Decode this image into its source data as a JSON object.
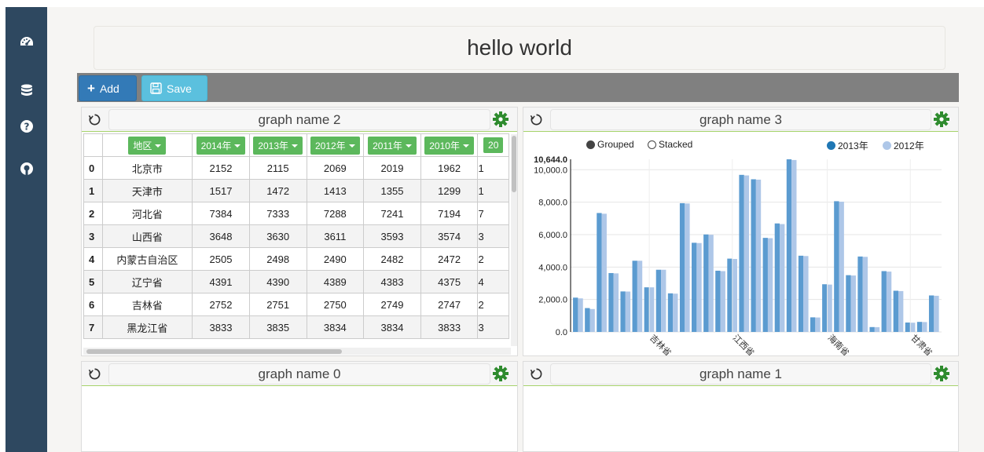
{
  "header": {
    "title": "hello world"
  },
  "toolbar": {
    "add_label": "Add",
    "save_label": "Save"
  },
  "sidebar": {
    "items": [
      {
        "icon": "dashboard-icon"
      },
      {
        "icon": "database-icon"
      },
      {
        "icon": "help-icon"
      },
      {
        "icon": "github-icon"
      }
    ]
  },
  "panels": {
    "p2": {
      "title": "graph name 2"
    },
    "p3": {
      "title": "graph name 3"
    },
    "p0": {
      "title": "graph name 0"
    },
    "p1": {
      "title": "graph name 1"
    }
  },
  "table": {
    "columns": [
      "地区",
      "2014年",
      "2013年",
      "2012年",
      "2011年",
      "2010年",
      "20"
    ],
    "rows": [
      {
        "idx": "0",
        "region": "北京市",
        "v": [
          "2152",
          "2115",
          "2069",
          "2019",
          "1962",
          "1"
        ]
      },
      {
        "idx": "1",
        "region": "天津市",
        "v": [
          "1517",
          "1472",
          "1413",
          "1355",
          "1299",
          "1"
        ]
      },
      {
        "idx": "2",
        "region": "河北省",
        "v": [
          "7384",
          "7333",
          "7288",
          "7241",
          "7194",
          "7"
        ]
      },
      {
        "idx": "3",
        "region": "山西省",
        "v": [
          "3648",
          "3630",
          "3611",
          "3593",
          "3574",
          "3"
        ]
      },
      {
        "idx": "4",
        "region": "内蒙古自治区",
        "v": [
          "2505",
          "2498",
          "2490",
          "2482",
          "2472",
          "2"
        ]
      },
      {
        "idx": "5",
        "region": "辽宁省",
        "v": [
          "4391",
          "4390",
          "4389",
          "4383",
          "4375",
          "4"
        ]
      },
      {
        "idx": "6",
        "region": "吉林省",
        "v": [
          "2752",
          "2751",
          "2750",
          "2749",
          "2747",
          "2"
        ]
      },
      {
        "idx": "7",
        "region": "黑龙江省",
        "v": [
          "3833",
          "3835",
          "3834",
          "3834",
          "3833",
          "3"
        ]
      }
    ]
  },
  "chart_controls": {
    "grouped_label": "Grouped",
    "stacked_label": "Stacked",
    "mode": "Grouped"
  },
  "colors": {
    "series_2013": "#5b9bd0",
    "series_2012": "#aec7e8",
    "panel_accent": "#a6d36b",
    "gear": "#2e8b2e"
  },
  "chart_data": {
    "type": "bar",
    "series": [
      {
        "name": "2013年",
        "values": [
          2115,
          1472,
          7333,
          3630,
          2498,
          4390,
          2751,
          3835,
          2380,
          7939,
          5498,
          6010,
          3775,
          4520,
          9685,
          9413,
          5800,
          6690,
          10644,
          4700,
          900,
          2940,
          8060,
          3500,
          4650,
          300,
          3750,
          2540,
          580,
          620,
          2250
        ]
      },
      {
        "name": "2012年",
        "values": [
          2069,
          1413,
          7288,
          3611,
          2490,
          4389,
          2750,
          3834,
          2360,
          7920,
          5480,
          5990,
          3750,
          4500,
          9650,
          9390,
          5780,
          6650,
          10600,
          4680,
          890,
          2920,
          8030,
          3480,
          4630,
          295,
          3720,
          2520,
          570,
          610,
          2230
        ]
      }
    ],
    "ylim": [
      0,
      10644
    ],
    "yticks": [
      "0.0",
      "2,000.0",
      "4,000.0",
      "6,000.0",
      "8,000.0",
      "10,000.0"
    ],
    "ymax_label": "10,644.0",
    "xtick_labels": [
      "吉林省",
      "江西省",
      "海南省",
      "甘肃省"
    ],
    "legend_position": "top-right"
  }
}
